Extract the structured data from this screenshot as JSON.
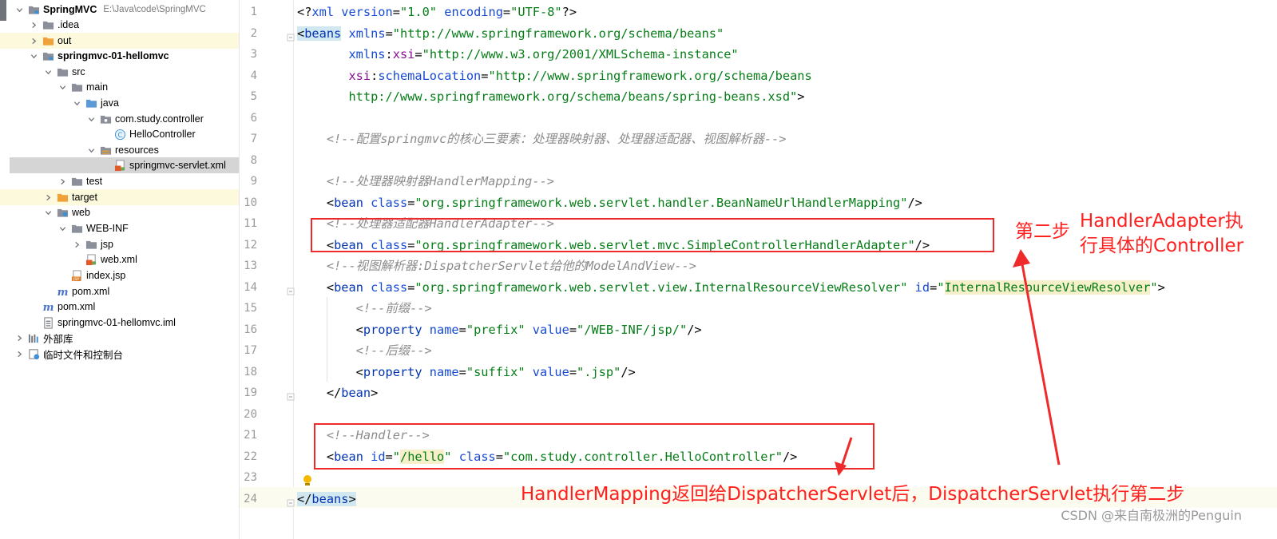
{
  "project_tree": {
    "items": [
      {
        "label": "SpringMVC",
        "path": "E:\\Java\\code\\SpringMVC",
        "bold": true,
        "icon": "folder-module-icon",
        "arrow": "down"
      },
      {
        "label": ".idea",
        "icon": "folder-icon",
        "arrow": "right"
      },
      {
        "label": "out",
        "icon": "folder-orange-icon",
        "arrow": "right",
        "highlight": "yellow"
      },
      {
        "label": "springmvc-01-hellomvc",
        "bold": true,
        "icon": "folder-module-icon",
        "arrow": "down"
      },
      {
        "label": "src",
        "icon": "folder-icon",
        "arrow": "down"
      },
      {
        "label": "main",
        "icon": "folder-icon",
        "arrow": "down"
      },
      {
        "label": "java",
        "icon": "folder-source-icon",
        "arrow": "down"
      },
      {
        "label": "com.study.controller",
        "icon": "package-icon",
        "arrow": "down"
      },
      {
        "label": "HelloController",
        "icon": "class-icon",
        "arrow": ""
      },
      {
        "label": "resources",
        "icon": "folder-resources-icon",
        "arrow": "down"
      },
      {
        "label": "springmvc-servlet.xml",
        "icon": "xml-file-icon",
        "arrow": "",
        "selected": true
      },
      {
        "label": "test",
        "icon": "folder-icon",
        "arrow": "right"
      },
      {
        "label": "target",
        "icon": "folder-orange-icon",
        "arrow": "right",
        "highlight": "yellow"
      },
      {
        "label": "web",
        "icon": "folder-web-icon",
        "arrow": "down"
      },
      {
        "label": "WEB-INF",
        "icon": "folder-icon",
        "arrow": "down"
      },
      {
        "label": "jsp",
        "icon": "folder-icon",
        "arrow": "right"
      },
      {
        "label": "web.xml",
        "icon": "xml-file-icon",
        "arrow": ""
      },
      {
        "label": "index.jsp",
        "icon": "jsp-file-icon",
        "arrow": ""
      },
      {
        "label": "pom.xml",
        "icon": "maven-icon",
        "arrow": ""
      },
      {
        "label": "pom.xml",
        "icon": "maven-icon",
        "arrow": ""
      },
      {
        "label": "springmvc-01-hellomvc.iml",
        "icon": "iml-file-icon",
        "arrow": ""
      },
      {
        "label": "外部库",
        "icon": "library-icon",
        "arrow": "right"
      },
      {
        "label": "临时文件和控制台",
        "icon": "scratch-icon",
        "arrow": "right"
      }
    ]
  },
  "editor": {
    "lines": [
      {
        "n": "1",
        "tokens": [
          {
            "t": "<?",
            "c": "c-plain"
          },
          {
            "t": "xml version",
            "c": "c-attr"
          },
          {
            "t": "=",
            "c": "c-plain"
          },
          {
            "t": "\"1.0\"",
            "c": "c-str"
          },
          {
            "t": " ",
            "c": "c-plain"
          },
          {
            "t": "encoding",
            "c": "c-attr"
          },
          {
            "t": "=",
            "c": "c-plain"
          },
          {
            "t": "\"UTF-8\"",
            "c": "c-str"
          },
          {
            "t": "?>",
            "c": "c-plain"
          }
        ]
      },
      {
        "n": "2",
        "tokens": [
          {
            "t": "<",
            "c": "c-plain c-hlbeans"
          },
          {
            "t": "beans",
            "c": "c-tag c-hlbeans"
          },
          {
            "t": " ",
            "c": "c-plain"
          },
          {
            "t": "xmlns",
            "c": "c-attr"
          },
          {
            "t": "=",
            "c": "c-plain"
          },
          {
            "t": "\"http://www.springframework.org/schema/beans\"",
            "c": "c-str"
          }
        ]
      },
      {
        "n": "3",
        "tokens": [
          {
            "t": "       ",
            "c": "c-plain"
          },
          {
            "t": "xmlns",
            "c": "c-attr"
          },
          {
            "t": ":",
            "c": "c-plain"
          },
          {
            "t": "xsi",
            "c": "c-ns"
          },
          {
            "t": "=",
            "c": "c-plain"
          },
          {
            "t": "\"http://www.w3.org/2001/XMLSchema-instance\"",
            "c": "c-str"
          }
        ]
      },
      {
        "n": "4",
        "tokens": [
          {
            "t": "       ",
            "c": "c-plain"
          },
          {
            "t": "xsi",
            "c": "c-ns"
          },
          {
            "t": ":",
            "c": "c-plain"
          },
          {
            "t": "schemaLocation",
            "c": "c-attr"
          },
          {
            "t": "=",
            "c": "c-plain"
          },
          {
            "t": "\"http://www.springframework.org/schema/beans",
            "c": "c-str"
          }
        ]
      },
      {
        "n": "5",
        "tokens": [
          {
            "t": "       http://www.springframework.org/schema/beans/spring-beans.xsd\"",
            "c": "c-str"
          },
          {
            "t": ">",
            "c": "c-plain"
          }
        ]
      },
      {
        "n": "6",
        "tokens": []
      },
      {
        "n": "7",
        "tokens": [
          {
            "t": "    <!--配置springmvc的核心三要素：处理器映射器、处理器适配器、视图解析器-->",
            "c": "c-com"
          }
        ]
      },
      {
        "n": "8",
        "tokens": []
      },
      {
        "n": "9",
        "tokens": [
          {
            "t": "    <!--处理器映射器HandlerMapping-->",
            "c": "c-com"
          }
        ]
      },
      {
        "n": "10",
        "tokens": [
          {
            "t": "    <",
            "c": "c-plain"
          },
          {
            "t": "bean",
            "c": "c-tag"
          },
          {
            "t": " ",
            "c": "c-plain"
          },
          {
            "t": "class",
            "c": "c-attr"
          },
          {
            "t": "=",
            "c": "c-plain"
          },
          {
            "t": "\"org.springframework.web.servlet.handler.BeanNameUrlHandlerMapping\"",
            "c": "c-str"
          },
          {
            "t": "/>",
            "c": "c-plain"
          }
        ]
      },
      {
        "n": "11",
        "tokens": [
          {
            "t": "    <!--处理器适配器HandlerAdapter-->",
            "c": "c-com"
          }
        ]
      },
      {
        "n": "12",
        "tokens": [
          {
            "t": "    <",
            "c": "c-plain"
          },
          {
            "t": "bean",
            "c": "c-tag"
          },
          {
            "t": " ",
            "c": "c-plain"
          },
          {
            "t": "class",
            "c": "c-attr"
          },
          {
            "t": "=",
            "c": "c-plain"
          },
          {
            "t": "\"org.springframework.web.servlet.mvc.SimpleControllerHandlerAdapter\"",
            "c": "c-str"
          },
          {
            "t": "/>",
            "c": "c-plain"
          }
        ]
      },
      {
        "n": "13",
        "tokens": [
          {
            "t": "    <!--视图解析器:DispatcherServlet给他的ModelAndView-->",
            "c": "c-com"
          }
        ]
      },
      {
        "n": "14",
        "tokens": [
          {
            "t": "    <",
            "c": "c-plain"
          },
          {
            "t": "bean",
            "c": "c-tag"
          },
          {
            "t": " ",
            "c": "c-plain"
          },
          {
            "t": "class",
            "c": "c-attr"
          },
          {
            "t": "=",
            "c": "c-plain"
          },
          {
            "t": "\"org.springframework.web.servlet.view.InternalResourceViewResolver\"",
            "c": "c-str"
          },
          {
            "t": " ",
            "c": "c-plain"
          },
          {
            "t": "id",
            "c": "c-attr"
          },
          {
            "t": "=",
            "c": "c-plain"
          },
          {
            "t": "\"",
            "c": "c-str"
          },
          {
            "t": "InternalResourceViewResolver",
            "c": "c-str c-hlval"
          },
          {
            "t": "\"",
            "c": "c-str"
          },
          {
            "t": ">",
            "c": "c-plain"
          }
        ]
      },
      {
        "n": "15",
        "tokens": [
          {
            "t": "        <!--前缀-->",
            "c": "c-com"
          }
        ]
      },
      {
        "n": "16",
        "tokens": [
          {
            "t": "        <",
            "c": "c-plain"
          },
          {
            "t": "property",
            "c": "c-tag"
          },
          {
            "t": " ",
            "c": "c-plain"
          },
          {
            "t": "name",
            "c": "c-attr"
          },
          {
            "t": "=",
            "c": "c-plain"
          },
          {
            "t": "\"prefix\"",
            "c": "c-str"
          },
          {
            "t": " ",
            "c": "c-plain"
          },
          {
            "t": "value",
            "c": "c-attr"
          },
          {
            "t": "=",
            "c": "c-plain"
          },
          {
            "t": "\"/WEB-INF/jsp/\"",
            "c": "c-str"
          },
          {
            "t": "/>",
            "c": "c-plain"
          }
        ]
      },
      {
        "n": "17",
        "tokens": [
          {
            "t": "        <!--后缀-->",
            "c": "c-com"
          }
        ]
      },
      {
        "n": "18",
        "tokens": [
          {
            "t": "        <",
            "c": "c-plain"
          },
          {
            "t": "property",
            "c": "c-tag"
          },
          {
            "t": " ",
            "c": "c-plain"
          },
          {
            "t": "name",
            "c": "c-attr"
          },
          {
            "t": "=",
            "c": "c-plain"
          },
          {
            "t": "\"suffix\"",
            "c": "c-str"
          },
          {
            "t": " ",
            "c": "c-plain"
          },
          {
            "t": "value",
            "c": "c-attr"
          },
          {
            "t": "=",
            "c": "c-plain"
          },
          {
            "t": "\".jsp\"",
            "c": "c-str"
          },
          {
            "t": "/>",
            "c": "c-plain"
          }
        ]
      },
      {
        "n": "19",
        "tokens": [
          {
            "t": "    </",
            "c": "c-plain"
          },
          {
            "t": "bean",
            "c": "c-tag"
          },
          {
            "t": ">",
            "c": "c-plain"
          }
        ]
      },
      {
        "n": "20",
        "tokens": []
      },
      {
        "n": "21",
        "tokens": [
          {
            "t": "    <!--Handler-->",
            "c": "c-com"
          }
        ]
      },
      {
        "n": "22",
        "tokens": [
          {
            "t": "    <",
            "c": "c-plain"
          },
          {
            "t": "bean",
            "c": "c-tag"
          },
          {
            "t": " ",
            "c": "c-plain"
          },
          {
            "t": "id",
            "c": "c-attr"
          },
          {
            "t": "=",
            "c": "c-plain"
          },
          {
            "t": "\"",
            "c": "c-str"
          },
          {
            "t": "/hello",
            "c": "c-str c-hlval"
          },
          {
            "t": "\"",
            "c": "c-str"
          },
          {
            "t": " ",
            "c": "c-plain"
          },
          {
            "t": "class",
            "c": "c-attr"
          },
          {
            "t": "=",
            "c": "c-plain"
          },
          {
            "t": "\"com.study.controller.HelloController\"",
            "c": "c-str"
          },
          {
            "t": "/>",
            "c": "c-plain"
          }
        ]
      },
      {
        "n": "23",
        "tokens": []
      },
      {
        "n": "24",
        "tokens": [
          {
            "t": "</",
            "c": "c-plain c-hlbeans"
          },
          {
            "t": "beans",
            "c": "c-tag c-hlbeans"
          },
          {
            "t": ">",
            "c": "c-plain c-hlbeans"
          }
        ]
      }
    ]
  },
  "annotations": {
    "step2_label": "第二步",
    "adapter_note_line1": "HandlerAdapter执",
    "adapter_note_line2": "行具体的Controller",
    "bottom_note": "HandlerMapping返回给DispatcherServlet后，DispatcherServlet执行第二步",
    "color": "#ff2020"
  },
  "watermark": "CSDN @来自南极洲的Penguin"
}
